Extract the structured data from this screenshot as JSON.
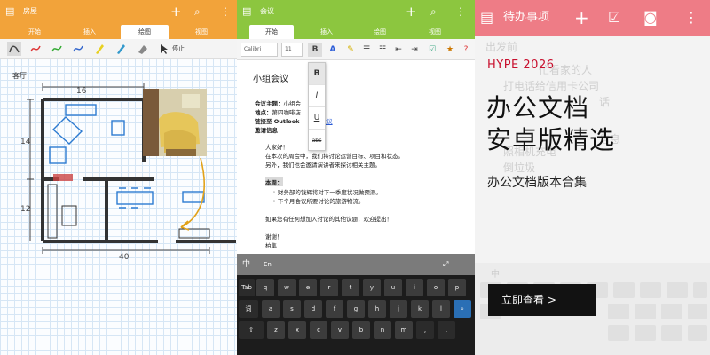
{
  "panel_drawing": {
    "title": "房屋",
    "tabs": [
      "开始",
      "插入",
      "绘图",
      "视图"
    ],
    "active_tab": 2,
    "stop_label": "停止",
    "room_label": "客厅",
    "dims": {
      "top": "16",
      "left": "14",
      "left_lower": "12",
      "bottom": "40"
    },
    "accent": "#f2a33a"
  },
  "panel_notes": {
    "title": "会议",
    "tabs": [
      "开始",
      "插入",
      "绘图",
      "视图"
    ],
    "active_tab": 0,
    "font_name": "Calibri",
    "font_size": "11",
    "format_options": [
      "B",
      "I",
      "U",
      "abc"
    ],
    "doc_title": "小组会议",
    "meta": [
      {
        "label": "会议主题：",
        "value": "小组会"
      },
      {
        "label": "地点：",
        "value": "第四咖啡店"
      },
      {
        "label": "链接至 Outlook",
        "value": "会议"
      },
      {
        "label": "邀请信息",
        "value": ""
      }
    ],
    "body": [
      "大家好！",
      "在本次的周会中，我们将讨论运营目标、项目和状态。",
      "另外，我们也会邀请演讲者来探讨相关主题。",
      "本周：",
      "财务部的钱辉将对下一季度状况做预测。",
      "下个月会议所要讨论的旅游物流。",
      "如果您有任何想加入讨论的其他议题，欢迎提出！",
      "谢谢！",
      "柏隼"
    ],
    "keyboard": {
      "lang": "中",
      "en": "En",
      "row1": [
        "q",
        "w",
        "e",
        "r",
        "t",
        "y",
        "u",
        "i",
        "o",
        "p"
      ],
      "row2": [
        "a",
        "s",
        "d",
        "f",
        "g",
        "h",
        "j",
        "k",
        "l"
      ],
      "row3": [
        "z",
        "x",
        "c",
        "v",
        "b",
        "n",
        "m"
      ],
      "tab": "Tab",
      "ci": "词"
    },
    "accent": "#8cc63f"
  },
  "panel_promo": {
    "ghost_title": "待办事项",
    "ghost_lines": [
      "出发前",
      "忙看家的人",
      "打电话给信用卡公司",
      "话",
      "信息",
      "照相机充电",
      "倒垃圾"
    ],
    "ghost_key": "中",
    "brand": "HYPE 2026",
    "headline_1": "办公文档",
    "headline_2": "安卓版精选",
    "subline": "办公文档版本合集",
    "cta_label": "立即查看 >",
    "brand_color": "#c8102e",
    "accent": "#ee7c86"
  }
}
